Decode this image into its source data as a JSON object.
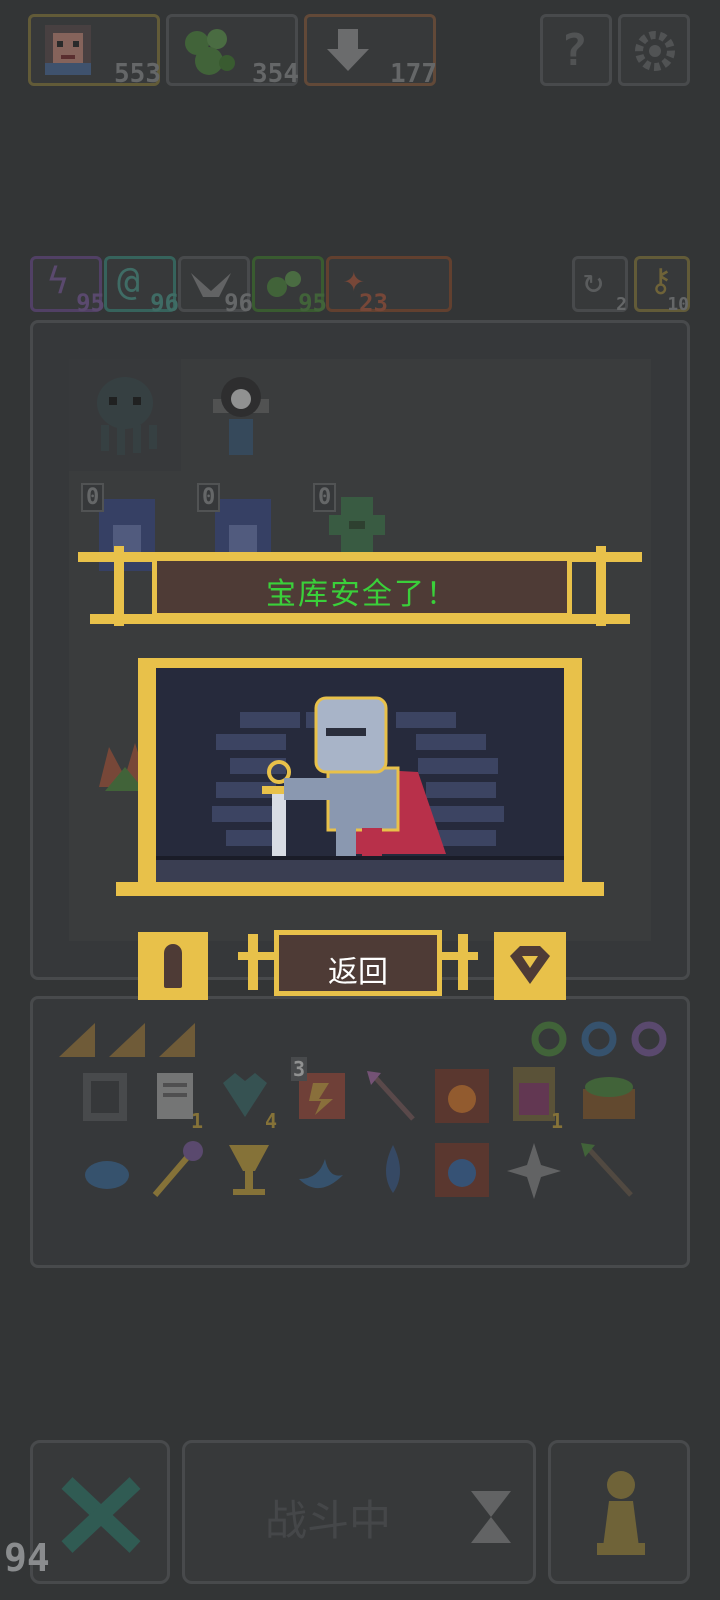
{
  "resources": [
    {
      "icon": "hero-portrait-icon",
      "value": "553"
    },
    {
      "icon": "green-orbs-icon",
      "value": "354"
    },
    {
      "icon": "download-arrow-icon",
      "value": "177"
    }
  ],
  "top_buttons": [
    {
      "icon": "help-question-icon"
    },
    {
      "icon": "settings-gear-icon"
    }
  ],
  "elements": [
    {
      "icon": "lightning-icon",
      "value": "95",
      "color": "#7a5a9c"
    },
    {
      "icon": "swirl-icon",
      "value": "96",
      "color": "#4a9a8c"
    },
    {
      "icon": "wings-icon",
      "value": "96",
      "color": "#8a8a8a"
    },
    {
      "icon": "acid-icon",
      "value": "95",
      "color": "#4e8a3c"
    },
    {
      "icon": "fire-icon",
      "value": "23",
      "color": "#b0573a"
    }
  ],
  "side_counters": [
    {
      "icon": "refresh-icon",
      "value": "2"
    },
    {
      "icon": "key-icon",
      "value": "10"
    }
  ],
  "grid_badges": [
    "0",
    "0",
    "0"
  ],
  "modal": {
    "title": "宝库安全了！",
    "back_label": "返回"
  },
  "bottom_bar": {
    "status_label": "战斗中",
    "fps": "94"
  },
  "inventory_badges": {
    "scroll": "1",
    "heart": "4",
    "cards": "3",
    "potion": "1"
  },
  "colors": {
    "background": "#333536",
    "modal_gold": "#e8c14a",
    "modal_title_text": "#3ad03a",
    "modal_brown": "#4e3b36"
  }
}
